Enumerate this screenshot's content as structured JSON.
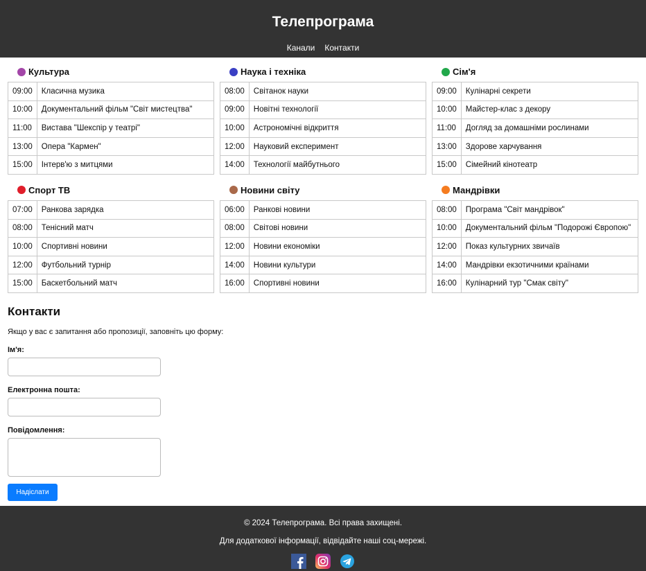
{
  "header": {
    "title": "Телепрограма",
    "nav": [
      "Канали",
      "Контакти"
    ]
  },
  "colors": {
    "header_bg": "#333333",
    "accent_button": "#0a7cff"
  },
  "channels": [
    {
      "name": "Культура",
      "dot": "#a346a8",
      "shows": [
        {
          "time": "09:00",
          "title": "Класична музика"
        },
        {
          "time": "10:00",
          "title": "Документальний фільм \"Світ мистецтва\""
        },
        {
          "time": "11:00",
          "title": "Вистава \"Шекспір у театрі\""
        },
        {
          "time": "13:00",
          "title": "Опера \"Кармен\""
        },
        {
          "time": "15:00",
          "title": "Інтерв'ю з митцями"
        }
      ]
    },
    {
      "name": "Наука і техніка",
      "dot": "#3a3fc4",
      "shows": [
        {
          "time": "08:00",
          "title": "Світанок науки"
        },
        {
          "time": "09:00",
          "title": "Новітні технології"
        },
        {
          "time": "10:00",
          "title": "Астрономічні відкриття"
        },
        {
          "time": "12:00",
          "title": "Науковий експеримент"
        },
        {
          "time": "14:00",
          "title": "Технології майбутнього"
        }
      ]
    },
    {
      "name": "Сім'я",
      "dot": "#21a84a",
      "shows": [
        {
          "time": "09:00",
          "title": "Кулінарні секрети"
        },
        {
          "time": "10:00",
          "title": "Майстер-клас з декору"
        },
        {
          "time": "11:00",
          "title": "Догляд за домашніми рослинами"
        },
        {
          "time": "13:00",
          "title": "Здорове харчування"
        },
        {
          "time": "15:00",
          "title": "Сімейний кінотеатр"
        }
      ]
    },
    {
      "name": "Спорт ТВ",
      "dot": "#e01e2b",
      "shows": [
        {
          "time": "07:00",
          "title": "Ранкова зарядка"
        },
        {
          "time": "08:00",
          "title": "Тенісний матч"
        },
        {
          "time": "10:00",
          "title": "Спортивні новини"
        },
        {
          "time": "12:00",
          "title": "Футбольний турнір"
        },
        {
          "time": "15:00",
          "title": "Баскетбольний матч"
        }
      ]
    },
    {
      "name": "Новини світу",
      "dot": "#a9694a",
      "shows": [
        {
          "time": "06:00",
          "title": "Ранкові новини"
        },
        {
          "time": "08:00",
          "title": "Світові новини"
        },
        {
          "time": "12:00",
          "title": "Новини економіки"
        },
        {
          "time": "14:00",
          "title": "Новини культури"
        },
        {
          "time": "16:00",
          "title": "Спортивні новини"
        }
      ]
    },
    {
      "name": "Мандрівки",
      "dot": "#f57c20",
      "shows": [
        {
          "time": "08:00",
          "title": "Програма \"Світ мандрівок\""
        },
        {
          "time": "10:00",
          "title": "Документальний фільм \"Подорожі Європою\""
        },
        {
          "time": "12:00",
          "title": "Показ культурних звичаїв"
        },
        {
          "time": "14:00",
          "title": "Мандрівки екзотичними країнами"
        },
        {
          "time": "16:00",
          "title": "Кулінарний тур \"Смак світу\""
        }
      ]
    }
  ],
  "contacts": {
    "heading": "Контакти",
    "intro": "Якщо у вас є запитання або пропозиції, заповніть цю форму:",
    "name_label": "Ім'я:",
    "name_value": "",
    "email_label": "Електронна пошта:",
    "email_value": "",
    "message_label": "Повідомлення:",
    "message_value": "",
    "submit_label": "Надіслати"
  },
  "footer": {
    "copyright": "© 2024 Телепрограма. Всі права захищені.",
    "info": "Для додаткової інформації, відвідайте наші соц-мережі.",
    "socials": [
      "facebook-icon",
      "instagram-icon",
      "telegram-icon"
    ]
  }
}
